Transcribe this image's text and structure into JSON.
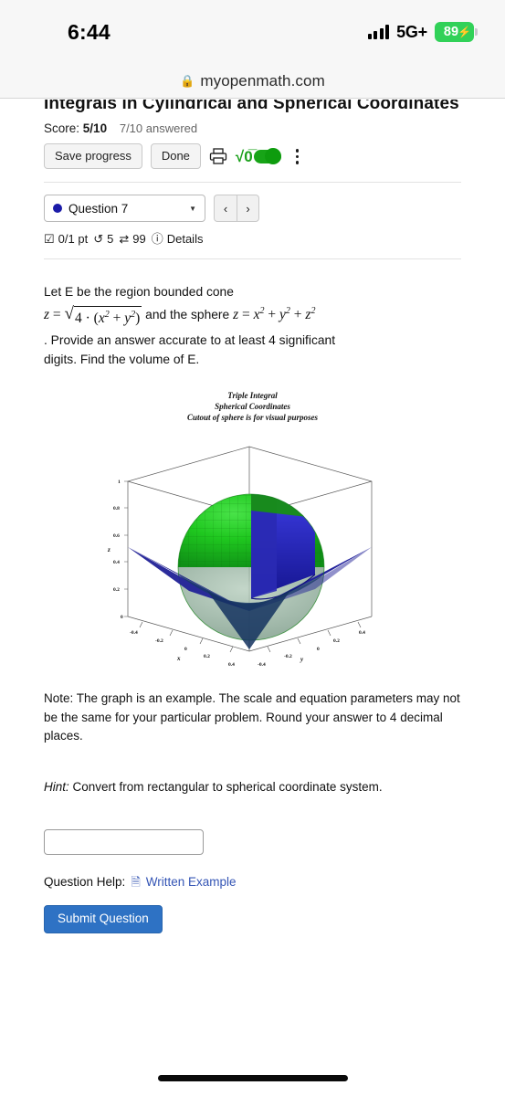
{
  "status_bar": {
    "time": "6:44",
    "network": "5G+",
    "battery_percent": "89",
    "charging_icon": "lightning-bolt-icon",
    "signal_icon": "cellular-signal-icon"
  },
  "browser": {
    "lock_icon": "lock-icon",
    "url": "myopenmath.com"
  },
  "assignment": {
    "title": "Integrals in Cylindrical and Spherical Coordinates",
    "score_label": "Score:",
    "score_value": "5/10",
    "answered": "7/10 answered"
  },
  "toolbar": {
    "save_label": "Save progress",
    "done_label": "Done",
    "print_icon": "printer-icon",
    "sqrt_icon": "square-root-icon",
    "toggle_state": "on",
    "menu_icon": "kebab-menu-icon"
  },
  "question_nav": {
    "selected": "Question 7",
    "status_dot_color": "#1b1ba8",
    "caret_icon": "chevron-down-icon",
    "prev_icon": "chevron-left-icon",
    "next_icon": "chevron-right-icon"
  },
  "question_meta": {
    "points_icon": "checkbox-icon",
    "points": "0/1 pt",
    "retry_icon": "undo-arrow-icon",
    "retries": "5",
    "attempts_icon": "swap-arrows-icon",
    "attempts": "99",
    "info_icon": "info-circle-icon",
    "details_label": "Details"
  },
  "question": {
    "line1": "Let E be the region bounded cone",
    "math_prefix": "z =",
    "math_radicand": "4 · (x² + y²)",
    "math_mid": "and the sphere",
    "math_sphere": "z = x² + y² + z²",
    "line3": ". Provide an answer accurate to at least 4 significant",
    "line4": "digits.   Find the volume of E."
  },
  "plot": {
    "title_line1": "Triple Integral",
    "title_line2": "Spherical Coordinates",
    "title_line3": "Cutout of sphere is for visual purposes",
    "z_label": "z",
    "x_label": "x",
    "y_label": "y",
    "z_ticks": [
      "1",
      "0.8",
      "0.6",
      "0.4",
      "0.2",
      "0"
    ],
    "x_ticks": [
      "-0.4",
      "-0.2",
      "0",
      "0.2",
      "0.4"
    ],
    "y_ticks": [
      "-0.4",
      "-0.2",
      "0",
      "0.2",
      "0.4"
    ],
    "sphere_color": "#18c018",
    "cone_color": "#2626c4"
  },
  "chart_data": {
    "type": "scatter",
    "title": "Triple Integral / Spherical Coordinates / Cutout of sphere is for visual purposes",
    "xlabel": "x",
    "ylabel": "y",
    "zlabel": "z",
    "xlim": [
      -0.5,
      0.5
    ],
    "ylim": [
      -0.5,
      0.5
    ],
    "zlim": [
      0,
      1
    ],
    "xticks": [
      -0.4,
      -0.2,
      0,
      0.2,
      0.4
    ],
    "yticks": [
      -0.4,
      -0.2,
      0,
      0.2,
      0.4
    ],
    "zticks": [
      0,
      0.2,
      0.4,
      0.6,
      0.8,
      1
    ],
    "grid": false,
    "series": [
      {
        "name": "sphere",
        "equation": "z = x^2 + y^2 + z^2",
        "color": "#18c018",
        "note": "cutout wedge removed for visual purposes"
      },
      {
        "name": "cone",
        "equation": "z = sqrt(4*(x^2 + y^2))",
        "color": "#2626c4"
      }
    ]
  },
  "note": {
    "text": "Note:  The graph is an example.  The scale and equation parameters may not be the same for your particular problem.  Round your answer to 4 decimal places."
  },
  "hint": {
    "label": "Hint:",
    "text": " Convert from rectangular to spherical coordinate system."
  },
  "answer": {
    "value": "",
    "placeholder": ""
  },
  "help": {
    "label": "Question Help:",
    "doc_icon": "document-icon",
    "link_label": "Written Example"
  },
  "submit": {
    "label": "Submit Question",
    "color": "#2e72c4"
  }
}
